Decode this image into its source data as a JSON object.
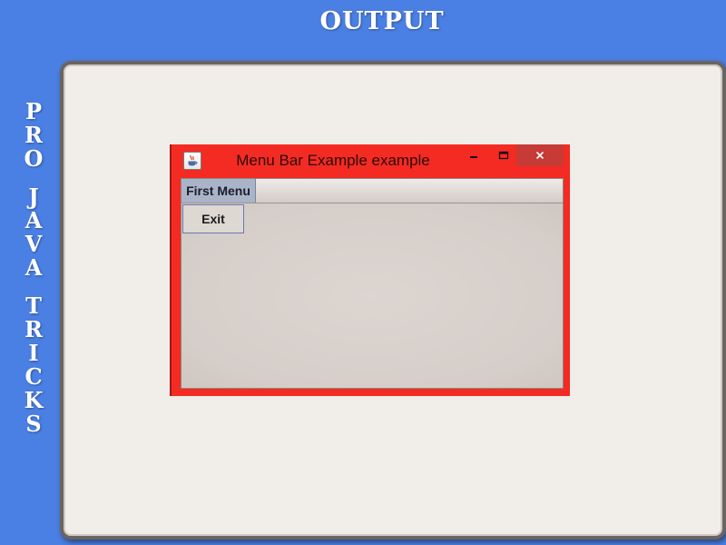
{
  "slide": {
    "title": "OUTPUT",
    "side_label_lines": [
      "P",
      "R",
      "O",
      "",
      "J",
      "A",
      "V",
      "A",
      "",
      "T",
      "R",
      "I",
      "C",
      "K",
      "S"
    ]
  },
  "window": {
    "title": "Menu Bar Example example",
    "icon": "java-cup-icon",
    "controls": {
      "minimize_glyph": "‒",
      "maximize_glyph": "▭",
      "close_glyph": "✕"
    }
  },
  "menu_bar": {
    "menus": [
      {
        "label": "First Menu",
        "items": [
          {
            "label": "Exit"
          }
        ]
      }
    ]
  },
  "colors": {
    "background": "#4a7fe3",
    "window_frame": "#f42b23",
    "close_button": "#c73a36",
    "menu_selected": "#aab4c9"
  }
}
